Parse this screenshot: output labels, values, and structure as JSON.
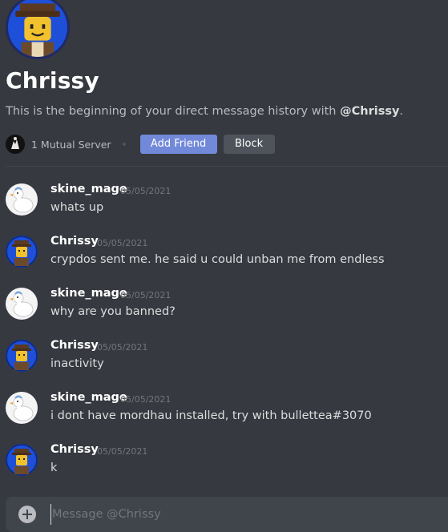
{
  "dm_header": {
    "title": "Chrissy",
    "subtitle_prefix": "This is the beginning of your direct message history with ",
    "subtitle_handle": "@Chrissy",
    "subtitle_suffix": ".",
    "mutual_servers": "1 Mutual Server",
    "add_friend_label": "Add Friend",
    "block_label": "Block"
  },
  "messages": [
    {
      "author": "skine_mage",
      "timestamp": "05/05/2021",
      "text": "whats up",
      "avatar": "duck-avatar"
    },
    {
      "author": "Chrissy",
      "timestamp": "05/05/2021",
      "text": "crypdos sent me.  he said u could unban me from endless",
      "avatar": "lego-avatar"
    },
    {
      "author": "skine_mage",
      "timestamp": "05/05/2021",
      "text": "why are you banned?",
      "avatar": "duck-avatar"
    },
    {
      "author": "Chrissy",
      "timestamp": "05/05/2021",
      "text": "inactivity",
      "avatar": "lego-avatar"
    },
    {
      "author": "skine_mage",
      "timestamp": "05/05/2021",
      "text": "i dont have mordhau installed, try with bullettea#3070",
      "avatar": "duck-avatar"
    },
    {
      "author": "Chrissy",
      "timestamp": "05/05/2021",
      "text": "k",
      "avatar": "lego-avatar"
    }
  ],
  "composer": {
    "placeholder": "Message @Chrissy",
    "value": ""
  },
  "colors": {
    "background": "#36393f",
    "accent": "#7289da",
    "button_secondary": "#4f545c",
    "timestamp": "#72767d"
  }
}
